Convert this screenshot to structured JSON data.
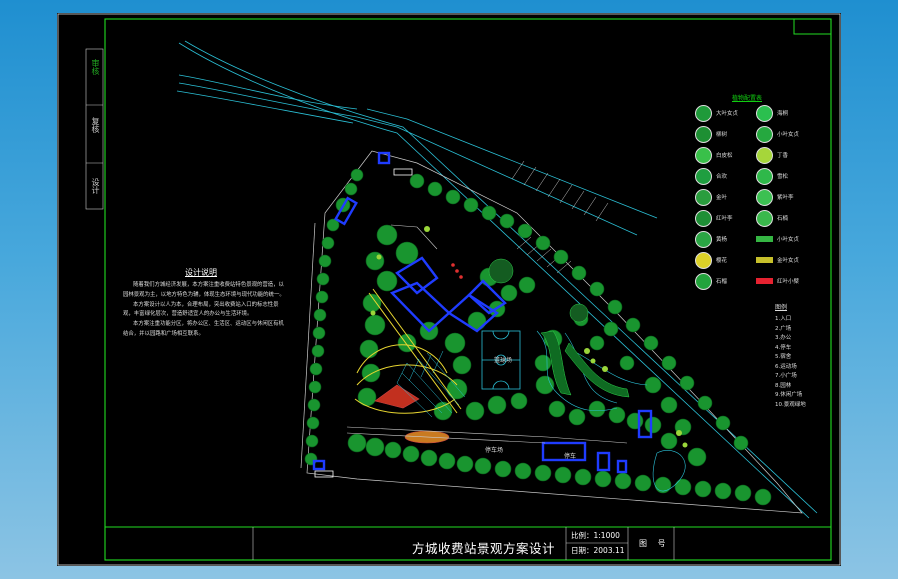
{
  "title_block": {
    "title": "方城收费站景观方案设计",
    "scale": "比例：1:1000",
    "date": "日期：2003.11",
    "drawing_no": "图 号"
  },
  "stamps": {
    "review": "审核",
    "check": "复核",
    "design": "设计"
  },
  "notes": {
    "title": "设计说明",
    "paragraphs": [
      "随着我们方城经济发展，本方案注重收费站特色景观的营造，以园林景观为主，以地方特色为辅，体现生态环境与现代功能的统一。",
      "本方案设计以人为本，合理布局，突出收费站入口的标志性景观，丰富绿化层次，营造舒适宜人的办公与生活环境。",
      "本方案注重功能分区，将办公区、生活区、运动区与休闲区有机结合，并以园路和广场相互联系。"
    ]
  },
  "legend": {
    "title": "植物配置表",
    "items": [
      {
        "label": "大叶女贞",
        "color": "#1f9a3a"
      },
      {
        "label": "海桐",
        "color": "#2bbf4f"
      },
      {
        "label": "柳树",
        "color": "#1d8f33"
      },
      {
        "label": "小叶女贞",
        "color": "#25a83f"
      },
      {
        "label": "白皮松",
        "color": "#39c04a"
      },
      {
        "label": "丁香",
        "color": "#a6d63a"
      },
      {
        "label": "合欢",
        "color": "#1f9e40"
      },
      {
        "label": "雪松",
        "color": "#2fb84a"
      },
      {
        "label": "金叶",
        "color": "#2a9d3e"
      },
      {
        "label": "紫叶李",
        "color": "#3cc052"
      },
      {
        "label": "红叶李",
        "color": "#1e8f36"
      },
      {
        "label": "石楠",
        "color": "#3ab84c"
      },
      {
        "label": "黄杨",
        "color": "#2aa544"
      },
      {
        "label": "小叶女贞",
        "color": "#35b543",
        "bar": true
      },
      {
        "label": "樱花",
        "color": "#dcd128"
      },
      {
        "label": "金叶女贞",
        "color": "#c7c02b",
        "bar": true
      },
      {
        "label": "石榴",
        "color": "#22a33c"
      },
      {
        "label": "红叶小檗",
        "color": "#e62230",
        "bar": true
      }
    ]
  },
  "key": {
    "title": "图例",
    "items": [
      "1.入口",
      "2.广场",
      "3.办公",
      "4.停车",
      "5.宿舍",
      "6.运动场",
      "7.小广场",
      "8.园林",
      "9.休闲广场",
      "10.景观绿地"
    ]
  },
  "plan_labels": {
    "court": "篮球场",
    "parking": "停车场",
    "p": "停车"
  }
}
